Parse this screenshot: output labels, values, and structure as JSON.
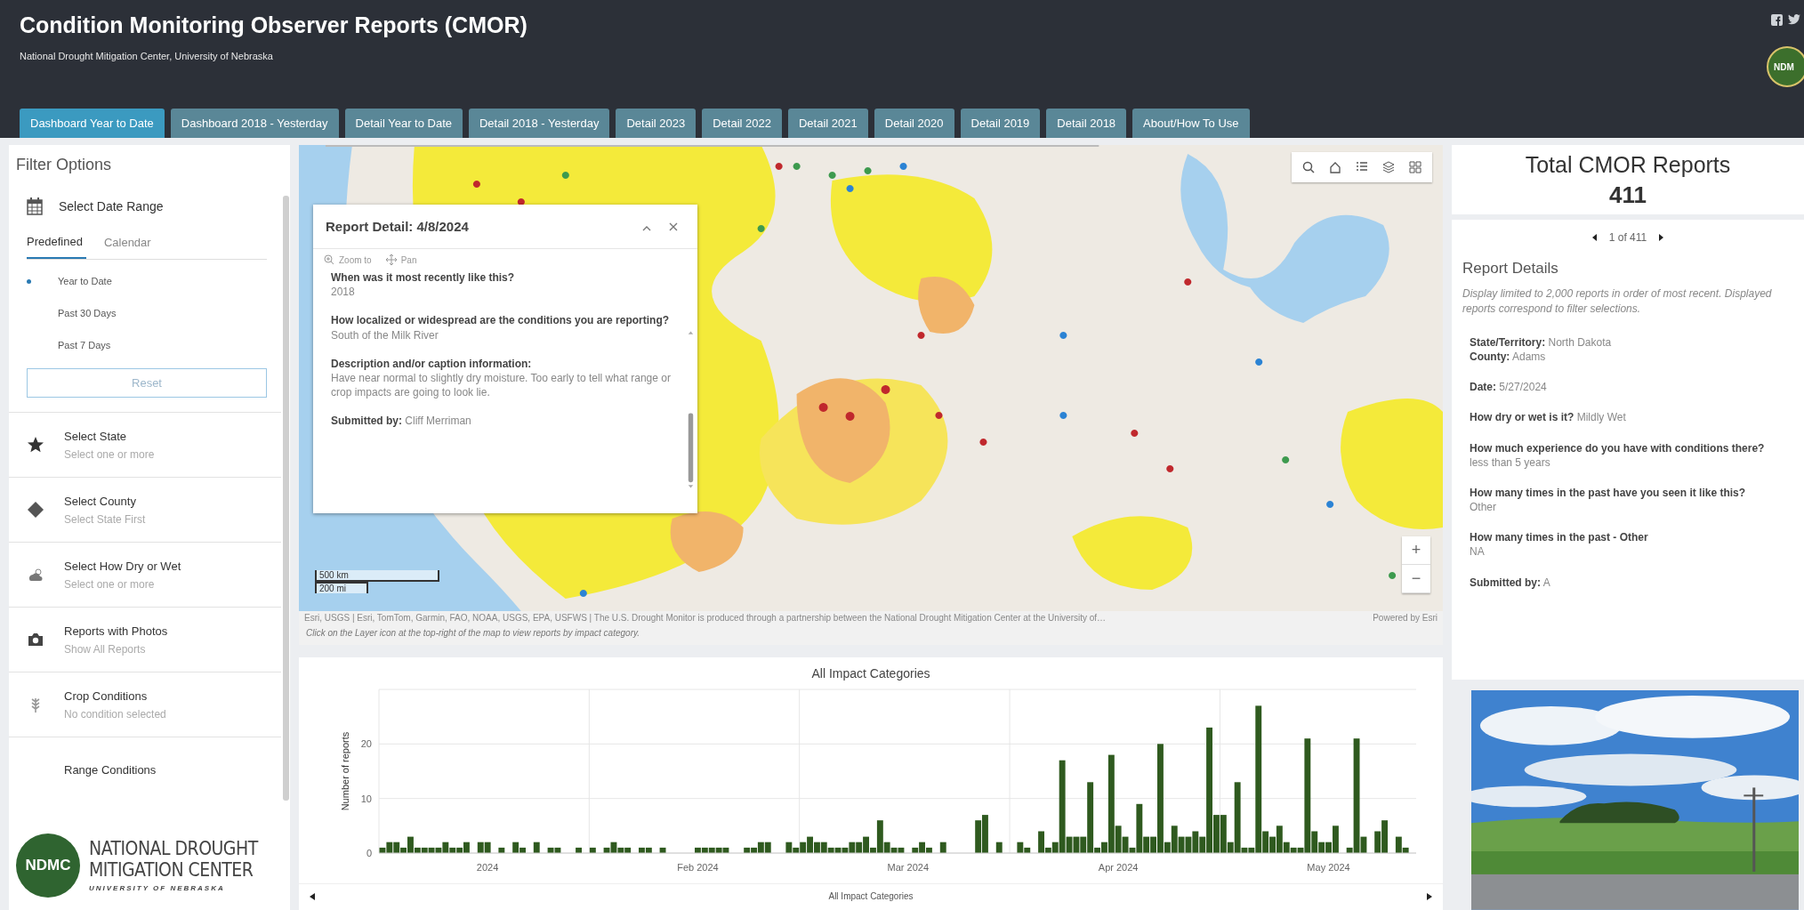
{
  "header": {
    "title": "Condition Monitoring Observer Reports (CMOR)",
    "subtitle": "National Drought Mitigation Center, University of Nebraska",
    "logo_text": "NDM"
  },
  "tabs": [
    {
      "label": "Dashboard Year to Date",
      "selected": true
    },
    {
      "label": "Dashboard 2018 - Yesterday",
      "selected": false
    },
    {
      "label": "Detail Year to Date",
      "selected": false
    },
    {
      "label": "Detail 2018 - Yesterday",
      "selected": false
    },
    {
      "label": "Detail 2023",
      "selected": false
    },
    {
      "label": "Detail 2022",
      "selected": false
    },
    {
      "label": "Detail 2021",
      "selected": false
    },
    {
      "label": "Detail 2020",
      "selected": false
    },
    {
      "label": "Detail 2019",
      "selected": false
    },
    {
      "label": "Detail 2018",
      "selected": false
    },
    {
      "label": "About/How To Use",
      "selected": false
    }
  ],
  "filter_panel": {
    "title": "Filter Options",
    "date_range": {
      "label": "Select Date Range",
      "tabs": [
        {
          "label": "Predefined",
          "selected": true
        },
        {
          "label": "Calendar",
          "selected": false
        }
      ],
      "options": [
        {
          "label": "Year to Date",
          "selected": true
        },
        {
          "label": "Past 30 Days",
          "selected": false
        },
        {
          "label": "Past 7 Days",
          "selected": false
        }
      ],
      "reset": "Reset"
    },
    "filters": [
      {
        "kind": "star",
        "label": "Select State",
        "hint": "Select one or more"
      },
      {
        "kind": "diamond",
        "label": "Select County",
        "hint": "Select State First"
      },
      {
        "kind": "weather",
        "label": "Select How Dry or Wet",
        "hint": "Select one or more"
      },
      {
        "kind": "camera",
        "label": "Reports with Photos",
        "hint": "Show All Reports"
      },
      {
        "kind": "crop",
        "label": "Crop Conditions",
        "hint": "No condition selected"
      },
      {
        "kind": "range",
        "label": "Range Conditions"
      }
    ]
  },
  "logo": {
    "badge": "NDMC",
    "line1": "NATIONAL DROUGHT",
    "line2": "MITIGATION CENTER",
    "line3": "UNIVERSITY OF NEBRASKA"
  },
  "map": {
    "scale": [
      "500 km",
      "200 mi"
    ],
    "zoom_buttons": [
      "+",
      "−"
    ],
    "attribution": "Esri, USGS | Esri, TomTom, Garmin, FAO, NOAA, USGS, EPA, USFWS | The U.S. Drought Monitor is produced through a partnership between the National Drought Mitigation Center at the University of…",
    "powered_by": "Powered by Esri",
    "caption": "Click on the Layer icon at the top-right of the map to view reports by impact category.",
    "popup": {
      "title": "Report Detail: 4/8/2024",
      "actions": [
        "Zoom to",
        "Pan"
      ],
      "groups": [
        [
          {
            "kind": "block",
            "label": "When was it most recently like this?",
            "value": "2018"
          }
        ],
        [
          {
            "kind": "block",
            "label": "How localized or widespread are the conditions you are reporting?",
            "value": "South of the Milk River"
          }
        ],
        [
          {
            "kind": "block",
            "label": "Description and/or caption information:",
            "value": "Have near normal to slightly dry moisture. Too early to tell what range or crop impacts are going to look lie."
          }
        ],
        [
          {
            "kind": "inline",
            "label": "Submitted by:",
            "value": "Cliff Merriman"
          }
        ]
      ]
    }
  },
  "chart": {
    "nav_label": "All Impact Categories",
    "chart_data": {
      "type": "bar",
      "title": "All Impact Categories",
      "ylabel": "Number of reports",
      "ylim": [
        0,
        30
      ],
      "yticks": [
        0,
        10,
        20
      ],
      "categories": [
        null,
        null,
        null,
        null,
        null,
        null,
        null,
        null,
        null,
        null,
        null,
        null,
        null,
        null,
        null,
        "2024",
        null,
        null,
        null,
        null,
        null,
        null,
        null,
        null,
        null,
        null,
        null,
        null,
        null,
        null,
        null,
        null,
        null,
        null,
        null,
        null,
        null,
        null,
        null,
        null,
        null,
        null,
        null,
        null,
        null,
        "Feb 2024",
        null,
        null,
        null,
        null,
        null,
        null,
        null,
        null,
        null,
        null,
        null,
        null,
        null,
        null,
        null,
        null,
        null,
        null,
        null,
        null,
        null,
        null,
        null,
        null,
        null,
        null,
        null,
        null,
        null,
        "Mar 2024",
        null,
        null,
        null,
        null,
        null,
        null,
        null,
        null,
        null,
        null,
        null,
        null,
        null,
        null,
        null,
        null,
        null,
        null,
        null,
        null,
        null,
        null,
        null,
        null,
        null,
        null,
        null,
        null,
        null,
        "Apr 2024",
        null,
        null,
        null,
        null,
        null,
        null,
        null,
        null,
        null,
        null,
        null,
        null,
        null,
        null,
        null,
        null,
        null,
        null,
        null,
        null,
        null,
        null,
        null,
        null,
        null,
        null,
        null,
        null,
        null,
        "May 2024",
        null,
        null,
        null,
        null,
        null,
        null,
        null,
        null,
        null,
        null,
        null,
        null
      ],
      "series": [
        {
          "color": "#2f5a1f",
          "values": [
            1,
            2,
            2,
            1,
            3,
            1,
            1,
            1,
            1,
            2,
            1,
            1,
            2,
            null,
            2,
            2,
            null,
            1,
            null,
            2,
            1,
            null,
            2,
            null,
            1,
            1,
            null,
            null,
            1,
            null,
            1,
            null,
            1,
            2,
            1,
            1,
            null,
            1,
            1,
            null,
            1,
            null,
            null,
            null,
            null,
            1,
            1,
            1,
            1,
            1,
            null,
            null,
            1,
            1,
            2,
            2,
            null,
            null,
            2,
            1,
            2,
            3,
            2,
            2,
            1,
            1,
            1,
            2,
            2,
            3,
            1,
            6,
            2,
            1,
            1,
            null,
            1,
            2,
            1,
            null,
            2,
            null,
            null,
            null,
            null,
            6,
            7,
            null,
            2,
            null,
            null,
            2,
            1,
            null,
            4,
            1,
            2,
            17,
            3,
            3,
            3,
            13,
            1,
            2,
            18,
            5,
            3,
            1,
            9,
            3,
            3,
            20,
            2,
            5,
            3,
            3,
            4,
            3,
            23,
            7,
            7,
            2,
            13,
            1,
            1,
            27,
            4,
            3,
            5,
            2,
            1,
            1,
            21,
            4,
            2,
            2,
            5,
            null,
            1,
            21,
            3,
            null,
            4,
            6,
            null,
            3,
            1,
            null
          ]
        }
      ]
    }
  },
  "summary": {
    "title": "Total CMOR Reports",
    "count": "411",
    "pager": "1 of 411"
  },
  "details": {
    "title": "Report Details",
    "note": "Display limited to 2,000 reports in order of most recent. Displayed reports correspond to filter selections.",
    "groups": [
      [
        {
          "kind": "inline",
          "label": "State/Territory:",
          "value": "North Dakota"
        },
        {
          "kind": "inline",
          "label": "County:",
          "value": "Adams"
        }
      ],
      [
        {
          "kind": "inline",
          "label": "Date:",
          "value": "5/27/2024"
        }
      ],
      [
        {
          "kind": "inline",
          "label": "How dry or wet is it?",
          "value": "Mildly Wet"
        }
      ],
      [
        {
          "kind": "block",
          "label": "How much experience do you have with conditions there?",
          "value": "less than 5 years"
        }
      ],
      [
        {
          "kind": "block",
          "label": "How many times in the past have you seen it like this?",
          "value": "Other"
        }
      ],
      [
        {
          "kind": "block",
          "label": "How many times in the past - Other",
          "value": "NA"
        }
      ],
      [
        {
          "kind": "inline",
          "label": "Submitted by:",
          "value": "A"
        }
      ]
    ]
  }
}
